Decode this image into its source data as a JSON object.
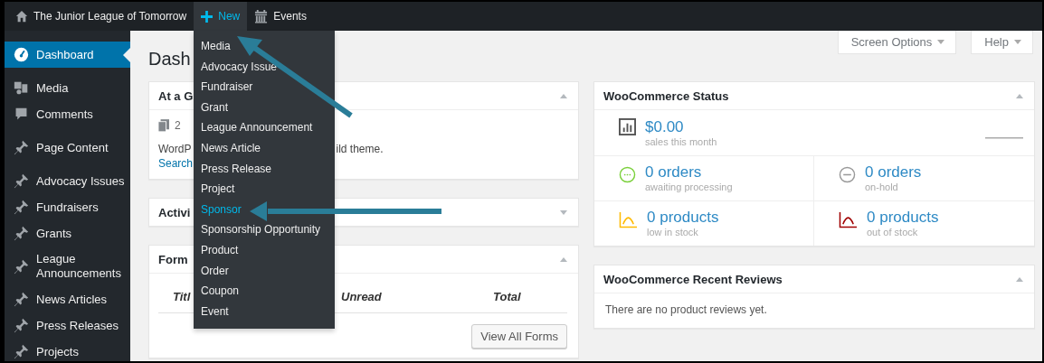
{
  "admin_bar": {
    "site_title": "The Junior League of Tomorrow",
    "items": [
      {
        "kind": "new",
        "label": "New",
        "selected": true
      },
      {
        "kind": "events",
        "label": "Events",
        "selected": false
      }
    ]
  },
  "new_menu": [
    {
      "label": "Media",
      "selected": false
    },
    {
      "label": "Advocacy Issue",
      "selected": false
    },
    {
      "label": "Fundraiser",
      "selected": false
    },
    {
      "label": "Grant",
      "selected": false
    },
    {
      "label": "League Announcement",
      "selected": false
    },
    {
      "label": "News Article",
      "selected": false
    },
    {
      "label": "Press Release",
      "selected": false
    },
    {
      "label": "Project",
      "selected": false
    },
    {
      "label": "Sponsor",
      "selected": true
    },
    {
      "label": "Sponsorship Opportunity",
      "selected": false
    },
    {
      "label": "Product",
      "selected": false
    },
    {
      "label": "Order",
      "selected": false
    },
    {
      "label": "Coupon",
      "selected": false
    },
    {
      "label": "Event",
      "selected": false
    }
  ],
  "sidebar": {
    "items": [
      {
        "kind": "dashboard",
        "label": "Dashboard",
        "selected": true
      },
      {
        "kind": "media",
        "label": "Media",
        "selected": false
      },
      {
        "kind": "comments",
        "label": "Comments",
        "selected": false
      },
      {
        "kind": "pin",
        "label": "Page Content",
        "selected": false
      },
      {
        "kind": "pin",
        "label": "Advocacy Issues",
        "selected": false
      },
      {
        "kind": "pin",
        "label": "Fundraisers",
        "selected": false
      },
      {
        "kind": "pin",
        "label": "Grants",
        "selected": false
      },
      {
        "kind": "pin",
        "label": "League Announcements",
        "selected": false
      },
      {
        "kind": "pin",
        "label": "News Articles",
        "selected": false
      },
      {
        "kind": "pin",
        "label": "Press Releases",
        "selected": false
      },
      {
        "kind": "pin",
        "label": "Projects",
        "selected": false
      }
    ]
  },
  "page_title": "Dash",
  "header_buttons": [
    "Screen Options",
    "Help"
  ],
  "at_a_glance": {
    "title": "At a G",
    "expanded": true,
    "count": "2",
    "text_left": "WordP",
    "text_right": "ild theme.",
    "link": "Search"
  },
  "activity": {
    "title": "Activi",
    "expanded": false
  },
  "forms": {
    "title": "Form",
    "expanded": true,
    "columns": [
      "Titl",
      "Unread",
      "Total"
    ],
    "button": "View All Forms"
  },
  "woocommerce_status": {
    "title": "WooCommerce Status",
    "expanded": true,
    "sales": {
      "amount": "$0.00",
      "caption": "sales this month"
    },
    "cells": [
      {
        "kind": "processing",
        "value": "0 orders",
        "caption": "awaiting processing"
      },
      {
        "kind": "on_hold",
        "value": "0 orders",
        "caption": "on-hold"
      },
      {
        "kind": "low_stock",
        "value": "0 products",
        "caption": "low in stock"
      },
      {
        "kind": "out_of_stock",
        "value": "0 products",
        "caption": "out of stock"
      }
    ]
  },
  "recent_reviews": {
    "title": "WooCommerce Recent Reviews",
    "expanded": true,
    "text": "There are no product reviews yet."
  }
}
